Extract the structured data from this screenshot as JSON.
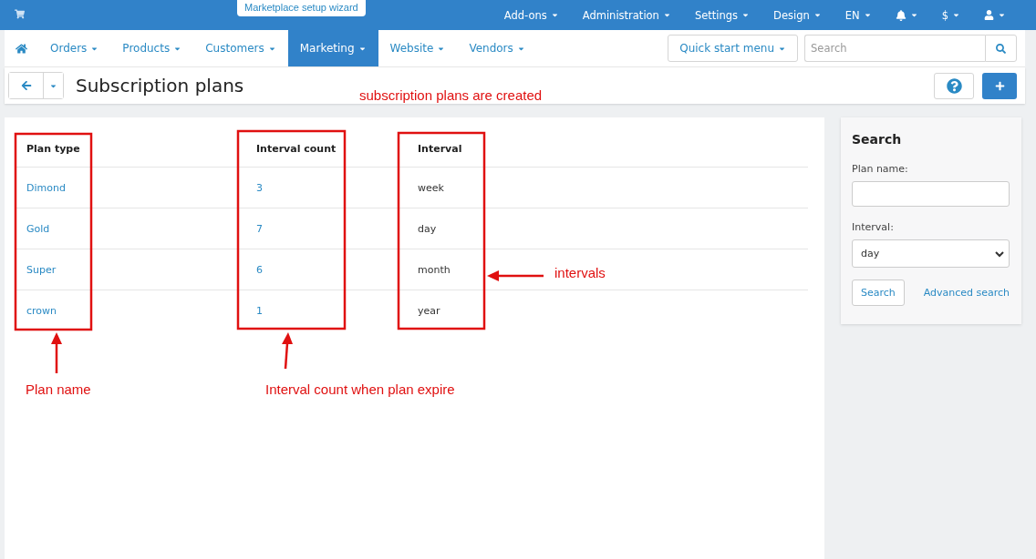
{
  "top_bar": {
    "wizard": "Marketplace setup wizard",
    "menus": [
      {
        "kind": "text",
        "label": "Add-ons"
      },
      {
        "kind": "text",
        "label": "Administration"
      },
      {
        "kind": "text",
        "label": "Settings"
      },
      {
        "kind": "text",
        "label": "Design"
      },
      {
        "kind": "text",
        "label": "EN"
      },
      {
        "kind": "bell"
      },
      {
        "kind": "text",
        "label": "$"
      },
      {
        "kind": "user"
      }
    ]
  },
  "nav": {
    "items": [
      {
        "label": "Orders",
        "selected": false
      },
      {
        "label": "Products",
        "selected": false
      },
      {
        "label": "Customers",
        "selected": false
      },
      {
        "label": "Marketing",
        "selected": true
      },
      {
        "label": "Website",
        "selected": false
      },
      {
        "label": "Vendors",
        "selected": false
      }
    ],
    "quick_start": "Quick start menu",
    "search": {
      "placeholder": "Search"
    }
  },
  "page_title": "Subscription plans",
  "table": {
    "columns": [
      "Plan type",
      "Interval count",
      "Interval"
    ],
    "rows": [
      [
        "Dimond",
        "3",
        "week"
      ],
      [
        "Gold",
        "7",
        "day"
      ],
      [
        "Super",
        "6",
        "month"
      ],
      [
        "crown",
        "1",
        "year"
      ]
    ]
  },
  "sidebar": {
    "title": "Search",
    "plan_name_label": "Plan name:",
    "interval_label": "Interval:",
    "interval_value": "day",
    "search_button": "Search",
    "advanced_link": "Advanced search"
  },
  "annotations": [
    "subscription plans are created",
    "Plan name",
    "Interval count when plan expire",
    "intervals"
  ]
}
